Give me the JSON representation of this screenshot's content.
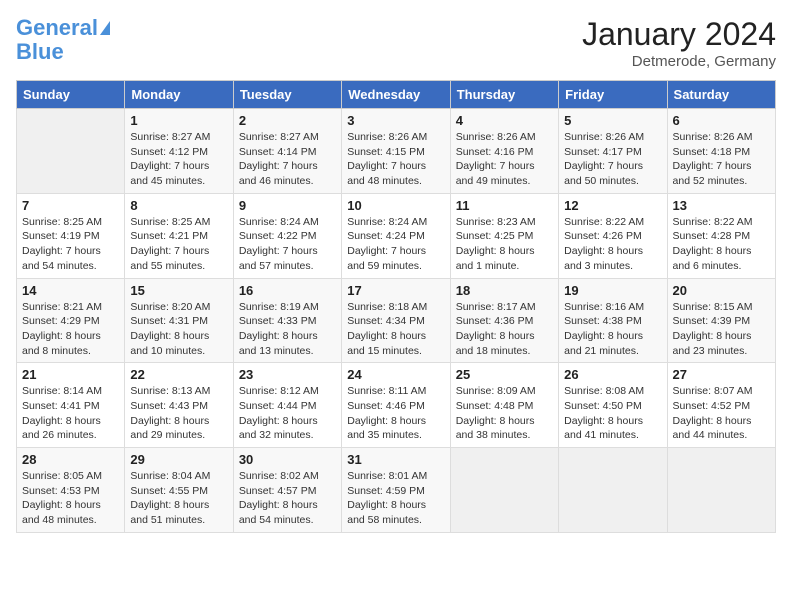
{
  "logo": {
    "line1": "General",
    "line2": "Blue"
  },
  "title": "January 2024",
  "location": "Detmerode, Germany",
  "days_header": [
    "Sunday",
    "Monday",
    "Tuesday",
    "Wednesday",
    "Thursday",
    "Friday",
    "Saturday"
  ],
  "weeks": [
    [
      {
        "day": "",
        "info": ""
      },
      {
        "day": "1",
        "info": "Sunrise: 8:27 AM\nSunset: 4:12 PM\nDaylight: 7 hours\nand 45 minutes."
      },
      {
        "day": "2",
        "info": "Sunrise: 8:27 AM\nSunset: 4:14 PM\nDaylight: 7 hours\nand 46 minutes."
      },
      {
        "day": "3",
        "info": "Sunrise: 8:26 AM\nSunset: 4:15 PM\nDaylight: 7 hours\nand 48 minutes."
      },
      {
        "day": "4",
        "info": "Sunrise: 8:26 AM\nSunset: 4:16 PM\nDaylight: 7 hours\nand 49 minutes."
      },
      {
        "day": "5",
        "info": "Sunrise: 8:26 AM\nSunset: 4:17 PM\nDaylight: 7 hours\nand 50 minutes."
      },
      {
        "day": "6",
        "info": "Sunrise: 8:26 AM\nSunset: 4:18 PM\nDaylight: 7 hours\nand 52 minutes."
      }
    ],
    [
      {
        "day": "7",
        "info": "Sunrise: 8:25 AM\nSunset: 4:19 PM\nDaylight: 7 hours\nand 54 minutes."
      },
      {
        "day": "8",
        "info": "Sunrise: 8:25 AM\nSunset: 4:21 PM\nDaylight: 7 hours\nand 55 minutes."
      },
      {
        "day": "9",
        "info": "Sunrise: 8:24 AM\nSunset: 4:22 PM\nDaylight: 7 hours\nand 57 minutes."
      },
      {
        "day": "10",
        "info": "Sunrise: 8:24 AM\nSunset: 4:24 PM\nDaylight: 7 hours\nand 59 minutes."
      },
      {
        "day": "11",
        "info": "Sunrise: 8:23 AM\nSunset: 4:25 PM\nDaylight: 8 hours\nand 1 minute."
      },
      {
        "day": "12",
        "info": "Sunrise: 8:22 AM\nSunset: 4:26 PM\nDaylight: 8 hours\nand 3 minutes."
      },
      {
        "day": "13",
        "info": "Sunrise: 8:22 AM\nSunset: 4:28 PM\nDaylight: 8 hours\nand 6 minutes."
      }
    ],
    [
      {
        "day": "14",
        "info": "Sunrise: 8:21 AM\nSunset: 4:29 PM\nDaylight: 8 hours\nand 8 minutes."
      },
      {
        "day": "15",
        "info": "Sunrise: 8:20 AM\nSunset: 4:31 PM\nDaylight: 8 hours\nand 10 minutes."
      },
      {
        "day": "16",
        "info": "Sunrise: 8:19 AM\nSunset: 4:33 PM\nDaylight: 8 hours\nand 13 minutes."
      },
      {
        "day": "17",
        "info": "Sunrise: 8:18 AM\nSunset: 4:34 PM\nDaylight: 8 hours\nand 15 minutes."
      },
      {
        "day": "18",
        "info": "Sunrise: 8:17 AM\nSunset: 4:36 PM\nDaylight: 8 hours\nand 18 minutes."
      },
      {
        "day": "19",
        "info": "Sunrise: 8:16 AM\nSunset: 4:38 PM\nDaylight: 8 hours\nand 21 minutes."
      },
      {
        "day": "20",
        "info": "Sunrise: 8:15 AM\nSunset: 4:39 PM\nDaylight: 8 hours\nand 23 minutes."
      }
    ],
    [
      {
        "day": "21",
        "info": "Sunrise: 8:14 AM\nSunset: 4:41 PM\nDaylight: 8 hours\nand 26 minutes."
      },
      {
        "day": "22",
        "info": "Sunrise: 8:13 AM\nSunset: 4:43 PM\nDaylight: 8 hours\nand 29 minutes."
      },
      {
        "day": "23",
        "info": "Sunrise: 8:12 AM\nSunset: 4:44 PM\nDaylight: 8 hours\nand 32 minutes."
      },
      {
        "day": "24",
        "info": "Sunrise: 8:11 AM\nSunset: 4:46 PM\nDaylight: 8 hours\nand 35 minutes."
      },
      {
        "day": "25",
        "info": "Sunrise: 8:09 AM\nSunset: 4:48 PM\nDaylight: 8 hours\nand 38 minutes."
      },
      {
        "day": "26",
        "info": "Sunrise: 8:08 AM\nSunset: 4:50 PM\nDaylight: 8 hours\nand 41 minutes."
      },
      {
        "day": "27",
        "info": "Sunrise: 8:07 AM\nSunset: 4:52 PM\nDaylight: 8 hours\nand 44 minutes."
      }
    ],
    [
      {
        "day": "28",
        "info": "Sunrise: 8:05 AM\nSunset: 4:53 PM\nDaylight: 8 hours\nand 48 minutes."
      },
      {
        "day": "29",
        "info": "Sunrise: 8:04 AM\nSunset: 4:55 PM\nDaylight: 8 hours\nand 51 minutes."
      },
      {
        "day": "30",
        "info": "Sunrise: 8:02 AM\nSunset: 4:57 PM\nDaylight: 8 hours\nand 54 minutes."
      },
      {
        "day": "31",
        "info": "Sunrise: 8:01 AM\nSunset: 4:59 PM\nDaylight: 8 hours\nand 58 minutes."
      },
      {
        "day": "",
        "info": ""
      },
      {
        "day": "",
        "info": ""
      },
      {
        "day": "",
        "info": ""
      }
    ]
  ]
}
